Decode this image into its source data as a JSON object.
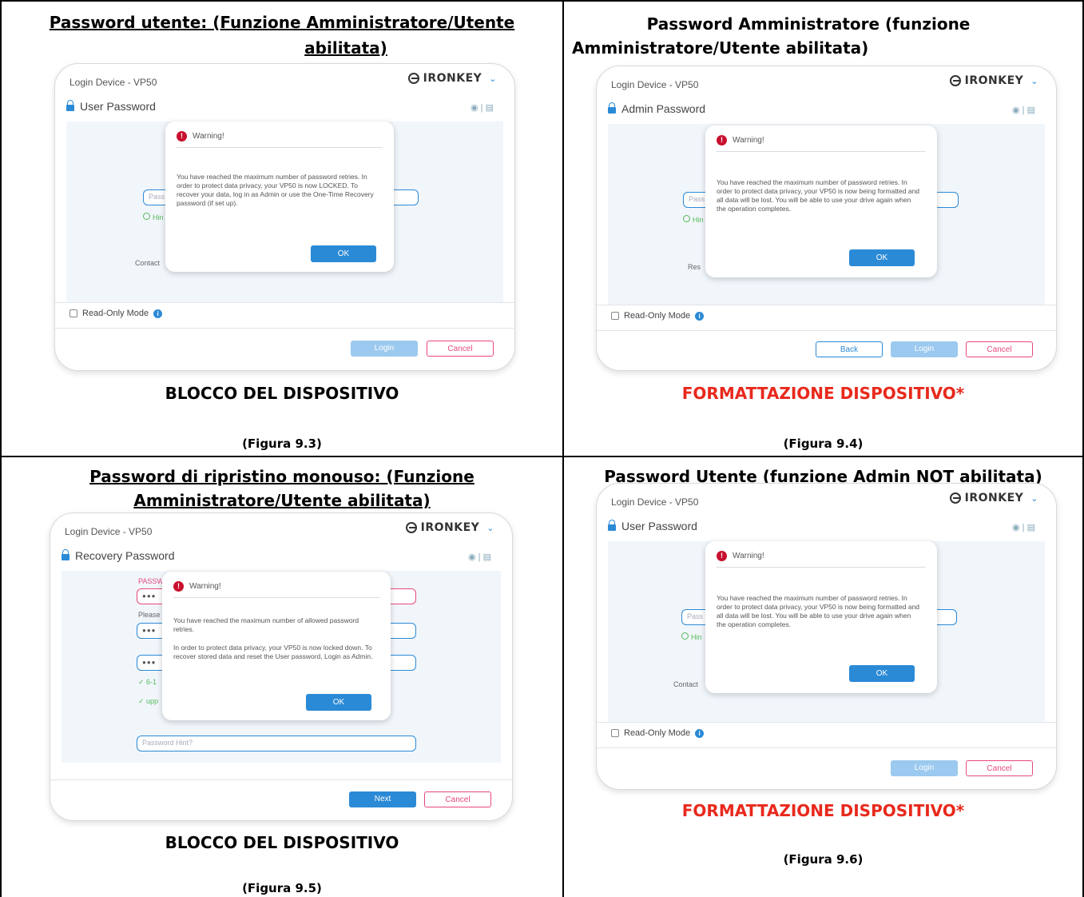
{
  "cells": [
    {
      "title_lines": [
        "Password utente: (Funzione Amministratore/Utente",
        "abilitata)"
      ],
      "underlined": true,
      "window": {
        "title": "Login Device - VP50",
        "brand": "IRONKEY",
        "password_label": "User Password",
        "input_placeholder": "Pass",
        "hint_stub": "Hin",
        "link_stub": "Contact",
        "read_only_label": "Read-Only Mode",
        "buttons": {
          "login": "Login",
          "cancel": "Cancel"
        },
        "dialog": {
          "title": "Warning!",
          "message": "You have reached the maximum number of password retries. In order to protect data privacy, your VP50 is now LOCKED. To recover your data, log in as Admin or use the One-Time Recovery password (if set up).",
          "ok": "OK"
        }
      },
      "caption": "BLOCCO DEL DISPOSITIVO",
      "figure": "(Figura 9.3)"
    },
    {
      "title_lines": [
        "Password Amministratore (funzione",
        "Amministratore/Utente abilitata)"
      ],
      "underlined": false,
      "window": {
        "title": "Login Device - VP50",
        "brand": "IRONKEY",
        "password_label": "Admin Password",
        "input_placeholder": "Pass",
        "hint_stub": "Hin",
        "link_stub": "Res",
        "read_only_label": "Read-Only Mode",
        "buttons": {
          "back": "Back",
          "login": "Login",
          "cancel": "Cancel"
        },
        "dialog": {
          "title": "Warning!",
          "message": "You have reached the maximum number of password retries. In order to protect data privacy, your VP50 is now being formatted and all data will be lost. You will be able to use your drive again when the operation completes.",
          "ok": "OK"
        }
      },
      "caption": "FORMATTAZIONE DISPOSITIVO*",
      "caption_color": "#e8291c",
      "figure": "(Figura 9.4)"
    },
    {
      "title_lines": [
        "Password di ripristino monouso: (Funzione",
        "Amministratore/Utente abilitata)"
      ],
      "underlined": true,
      "window": {
        "title": "Login Device - VP50",
        "brand": "IRONKEY",
        "password_label": "Recovery Password",
        "stub_password": "PASSW",
        "stub_please": "Please",
        "stub_check1": "✓ 6-1",
        "stub_check2": "✓ upp",
        "hint_placeholder": "Password Hint?",
        "buttons": {
          "next": "Next",
          "cancel": "Cancel"
        },
        "dialog": {
          "title": "Warning!",
          "message_1": "You have reached the maximum number of allowed password retries.",
          "message_2": "In order to protect data privacy, your VP50 is now locked down. To recover stored data and reset the User password, Login as Admin.",
          "ok": "OK"
        }
      },
      "caption": "BLOCCO DEL DISPOSITIVO",
      "figure": "(Figura 9.5)"
    },
    {
      "title_lines": [
        "Password Utente (funzione Admin NOT abilitata)"
      ],
      "underlined": false,
      "window": {
        "title": "Login Device - VP50",
        "brand": "IRONKEY",
        "password_label": "User Password",
        "input_placeholder": "Pass",
        "hint_stub": "Hin",
        "link_stub": "Contact",
        "read_only_label": "Read-Only Mode",
        "buttons": {
          "login": "Login",
          "cancel": "Cancel"
        },
        "dialog": {
          "title": "Warning!",
          "message": "You have reached the maximum number of password retries. In order to protect data privacy, your VP50 is now being formatted and all data will be lost. You will be able to use your drive again when the operation completes.",
          "ok": "OK"
        }
      },
      "caption": "FORMATTAZIONE DISPOSITIVO*",
      "caption_color": "#e8291c",
      "figure": "(Figura 9.6)"
    }
  ],
  "colors": {
    "accent": "#2b8ad6",
    "danger": "#e8497a",
    "caption_red": "#e8291c",
    "warning_icon": "#c8102e"
  },
  "icons": [
    "ironkey-logo-icon",
    "chevron-down-icon",
    "lock-icon",
    "eye-icon",
    "keyboard-icon",
    "warning-icon",
    "info-icon",
    "checkbox-icon",
    "radio-icon"
  ]
}
